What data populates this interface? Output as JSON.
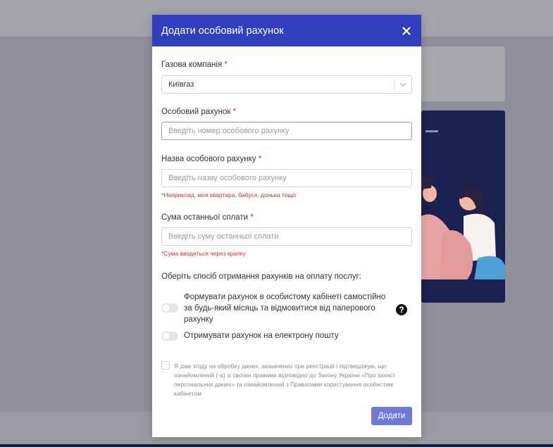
{
  "modal": {
    "title": "Додати особовий рахунок",
    "close_icon": "close-icon"
  },
  "form": {
    "company": {
      "label": "Газова компанія",
      "required_mark": "*",
      "value": "Київгаз"
    },
    "account": {
      "label": "Особовий рахунок",
      "required_mark": "*",
      "placeholder": "Введіть номер особового рахунку"
    },
    "account_name": {
      "label": "Назва особового рахунку",
      "required_mark": "*",
      "placeholder": "Введіть назву особового рахунку",
      "hint": "*Наприклад, моя квартира, бабуся, донька тощо"
    },
    "last_payment": {
      "label": "Сума останньої сплати",
      "required_mark": "*",
      "placeholder": "Введіть суму останньої сплати",
      "hint": "*Сума вводиться через крапку"
    }
  },
  "delivery": {
    "title": "Оберіть спосіб отримання рахунків на оплату послуг:",
    "options": [
      {
        "label": "Формувати рахунок в особистому кабінеті самостійно за будь-який місяць та відмовитися від паперового рахунку",
        "enabled": false
      },
      {
        "label": "Отримувати рахунок на електрону пошту",
        "enabled": false
      }
    ],
    "help_icon": "?"
  },
  "consent": {
    "text": "Я даю згоду на обробку даних, зазначених при реєстрації і підтверджую, що ознайомлений (-а) зі своїми правами відповідно до Закону України «Про захист персональних даних» та ознайомлений з Правилами користування особистим кабінетом",
    "checked": false
  },
  "submit_label": "Додати",
  "colors": {
    "header": "#2f3fbd",
    "button": "#6f79d6",
    "required": "#d9302a"
  }
}
